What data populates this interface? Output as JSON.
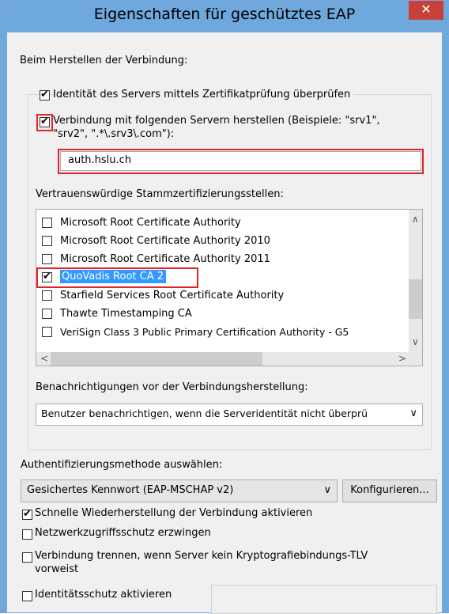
{
  "window": {
    "title": "Eigenschaften für geschütztes EAP",
    "close_glyph": "✕"
  },
  "connect_section": {
    "label": "Beim Herstellen der Verbindung:",
    "verify_identity": {
      "label": "Identität des Servers mittels Zertifikatprüfung überprüfen",
      "checked": true
    },
    "connect_servers": {
      "label_line1": "Verbindung mit folgenden Servern herstellen (Beispiele: \"srv1\",",
      "label_line2": "\"srv2\", \".*\\.srv3\\.com\"):",
      "checked": true
    },
    "servers_value": "auth.hslu.ch",
    "trusted_ca_label": "Vertrauenswürdige Stammzertifizierungsstellen:",
    "ca_list": [
      {
        "label": "Microsoft Root Certificate Authority",
        "checked": false,
        "selected": false
      },
      {
        "label": "Microsoft Root Certificate Authority 2010",
        "checked": false,
        "selected": false
      },
      {
        "label": "Microsoft Root Certificate Authority 2011",
        "checked": false,
        "selected": false
      },
      {
        "label": "QuoVadis Root CA 2",
        "checked": true,
        "selected": true
      },
      {
        "label": "Starfield Services Root Certificate Authority",
        "checked": false,
        "selected": false
      },
      {
        "label": "Thawte Timestamping CA",
        "checked": false,
        "selected": false
      },
      {
        "label": "VeriSign Class 3 Public Primary Certification Authority - G5",
        "checked": false,
        "selected": false
      }
    ],
    "notify_label": "Benachrichtigungen vor der Verbindungsherstellung:",
    "notify_value": "Benutzer benachrichtigen, wenn die Serveridentität nicht überprü"
  },
  "auth_section": {
    "label": "Authentifizierungsmethode auswählen:",
    "method_value": "Gesichertes Kennwort (EAP-MSCHAP v2)",
    "configure_label": "Konfigurieren..."
  },
  "options": [
    {
      "label": "Schnelle Wiederherstellung der Verbindung aktivieren",
      "checked": true
    },
    {
      "label": "Netzwerkzugriffsschutz erzwingen",
      "checked": false
    },
    {
      "label_line1": "Verbindung trennen, wenn Server kein Kryptografiebindungs-TLV",
      "label_line2": "vorweist",
      "checked": false
    },
    {
      "label": "Identitätsschutz aktivieren",
      "checked": false
    }
  ],
  "glyphs": {
    "check": "✔",
    "up": "∧",
    "down": "∨",
    "left": "<",
    "right": ">"
  },
  "colors": {
    "title_bar": "#6fa8dc",
    "close_button": "#c7413a",
    "highlight_red": "#e0242c",
    "selection_blue": "#3399ff"
  }
}
